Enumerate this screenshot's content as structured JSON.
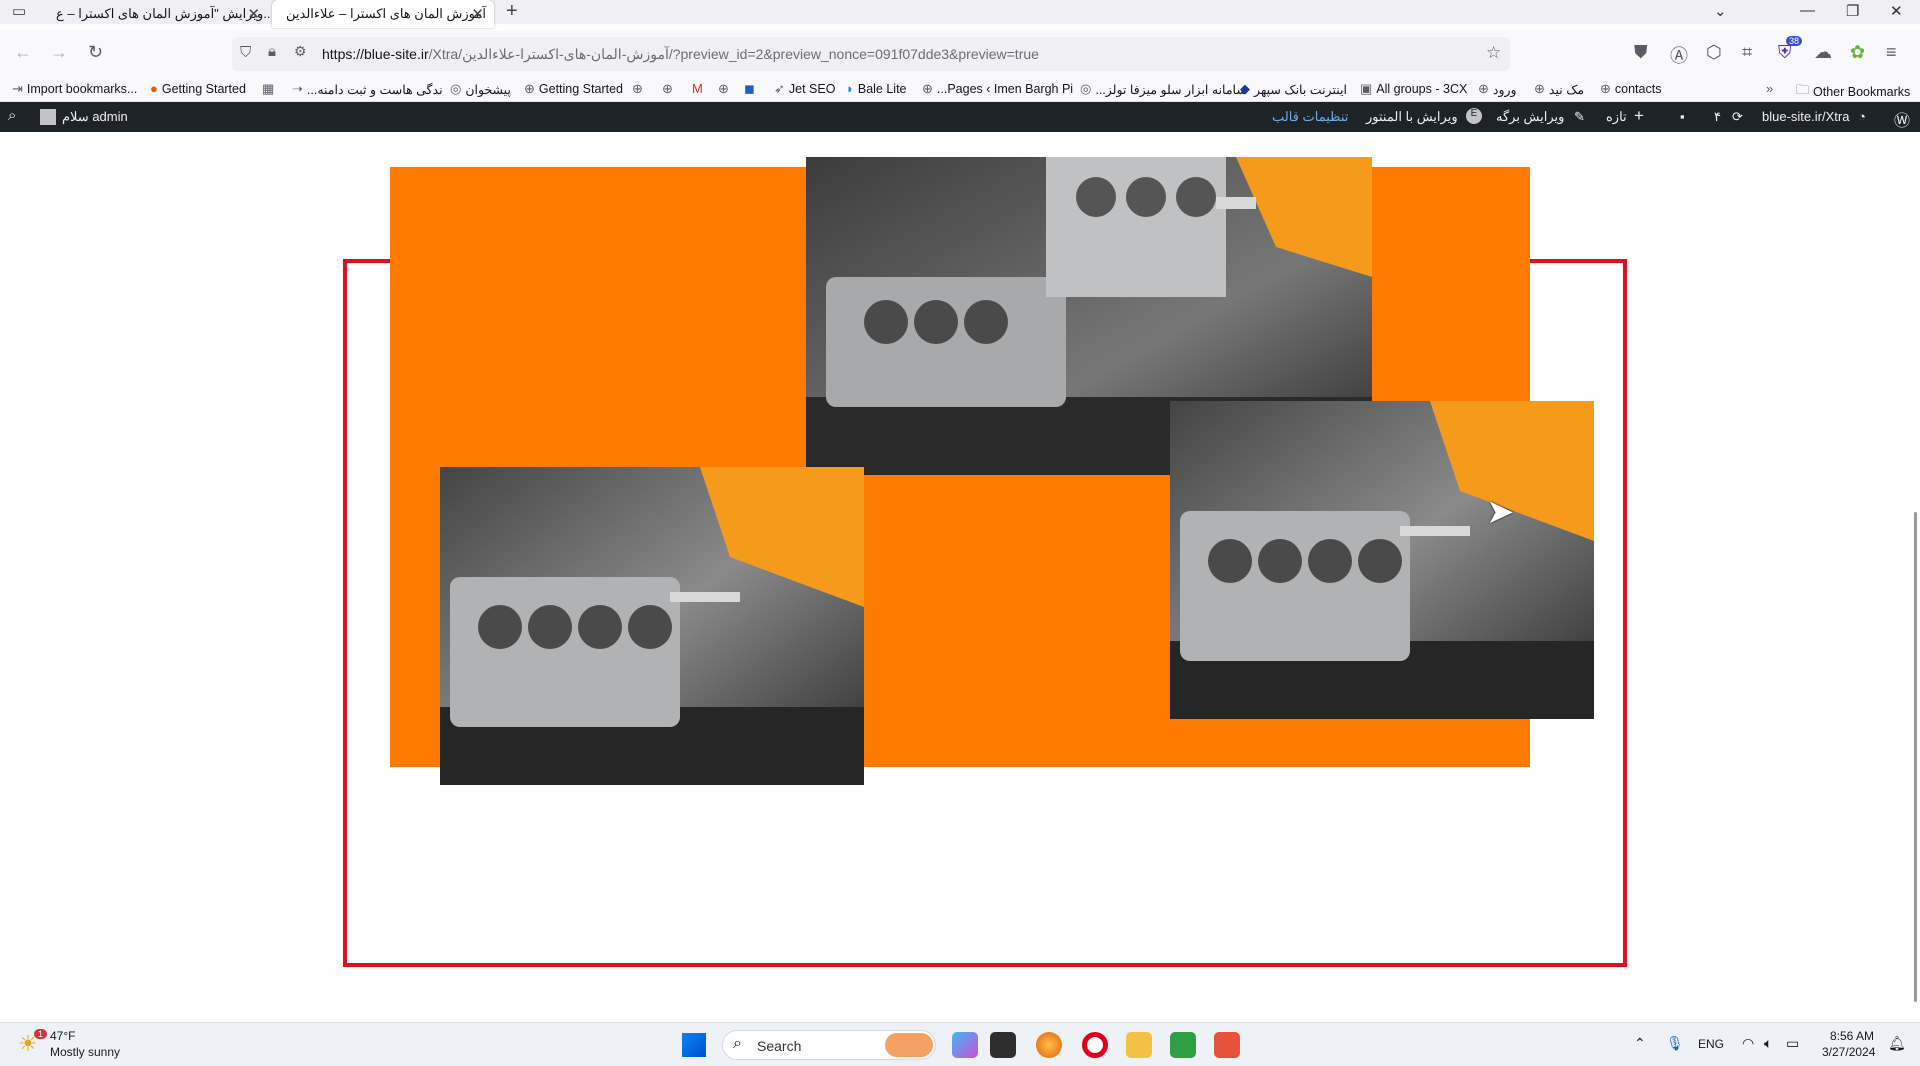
{
  "browser": {
    "tabs": [
      {
        "label": "ویرایش \"آموزش المان های اکسترا – ع...",
        "active": false
      },
      {
        "label": "آموزش المان های اکسترا – علاءالدین",
        "active": true
      }
    ],
    "new_tab": "+",
    "url_host": "https://blue-site.ir",
    "url_path": "/Xtra/آموزش-المان-های-اکسترا-علاءالدین/?preview_id=2&preview_nonce=091f07dde3&preview=true",
    "extension_badge": "38",
    "bookmarks": [
      "Import bookmarks...",
      "Getting Started",
      "...ندگی هاست و ثبت دامنه",
      "پیشخوان",
      "Getting Started",
      "Jet SEO",
      "Bale Lite",
      "...Pages ‹ Imen Bargh Pi",
      "...سامانه ابزار سلو میزفا تولز",
      "اینترنت بانک سپهر",
      "All groups - 3CX",
      "ورود",
      "مک نید",
      "contacts"
    ],
    "other_bookmarks": "Other Bookmarks"
  },
  "wp_admin_bar": {
    "greeting": "سلام admin",
    "site": "blue-site.ir/Xtra",
    "comments_count": "۴",
    "new": "تازه",
    "edit_page": "ویرایش برگه",
    "edit_elementor": "ویرایش با المنتور",
    "theme_settings": "تنظیمات قالب"
  },
  "taskbar": {
    "weather_temp": "47°F",
    "weather_desc": "Mostly sunny",
    "weather_badge": "1",
    "search": "Search",
    "lang": "ENG",
    "time": "8:56 AM",
    "date": "3/27/2024"
  },
  "colors": {
    "accent_orange": "#ff7b00",
    "frame_red": "#e30c20",
    "wp_bar": "#1d2327"
  }
}
